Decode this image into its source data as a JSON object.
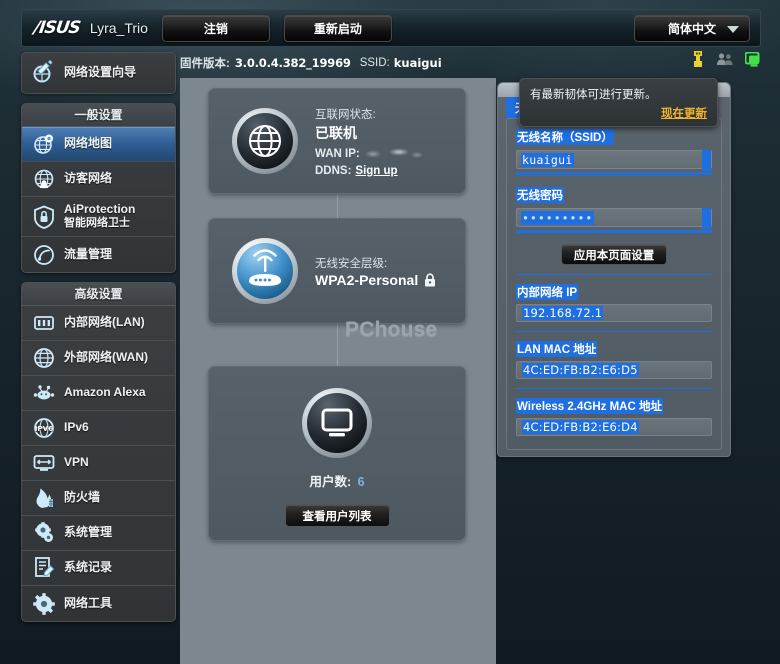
{
  "header": {
    "brand": "/ISUS",
    "model": "Lyra_Trio",
    "logout_label": "注销",
    "reboot_label": "重新启动",
    "language": "简体中文"
  },
  "info": {
    "firmware_label": "固件版本:",
    "firmware_version": "3.0.0.4.382_19969",
    "ssid_label": "SSID:",
    "ssid_value": "kuaigui",
    "icons": [
      "usb-icon",
      "guest-users-icon",
      "client-monitor-icon"
    ]
  },
  "sidebar": {
    "wizard": {
      "label": "网络设置向导",
      "icon": "wizard-icon"
    },
    "general": {
      "title": "一般设置",
      "items": [
        {
          "label": "网络地图",
          "icon": "network-map-icon",
          "active": true
        },
        {
          "label": "访客网络",
          "icon": "guest-network-icon",
          "active": false
        },
        {
          "label": "AiProtection",
          "sublabel": "智能网络卫士",
          "icon": "aiprotection-icon",
          "active": false
        },
        {
          "label": "流量管理",
          "icon": "traffic-manager-icon",
          "active": false
        }
      ]
    },
    "advanced": {
      "title": "高级设置",
      "items": [
        {
          "label": "内部网络(LAN)",
          "icon": "lan-icon"
        },
        {
          "label": "外部网络(WAN)",
          "icon": "wan-icon"
        },
        {
          "label": "Amazon Alexa",
          "icon": "alexa-icon"
        },
        {
          "label": "IPv6",
          "icon": "ipv6-icon"
        },
        {
          "label": "VPN",
          "icon": "vpn-icon"
        },
        {
          "label": "防火墙",
          "icon": "firewall-icon"
        },
        {
          "label": "系统管理",
          "icon": "administration-icon"
        },
        {
          "label": "系统记录",
          "icon": "system-log-icon"
        },
        {
          "label": "网络工具",
          "icon": "network-tools-icon"
        }
      ]
    }
  },
  "main": {
    "internet": {
      "icon": "globe-icon",
      "status_label": "互联网状态:",
      "status_value": "已联机",
      "wan_ip_label": "WAN IP:",
      "wan_ip_value": "",
      "ddns_label": "DDNS:",
      "ddns_link": "Sign up"
    },
    "wireless": {
      "icon": "router-icon",
      "security_label": "无线安全层级:",
      "security_value": "WPA2-Personal",
      "lock_icon": "lock-icon"
    },
    "clients": {
      "icon": "monitor-icon",
      "count_label": "用户数:",
      "count_value": "6",
      "view_button": "查看用户列表"
    },
    "watermark": "PChouse"
  },
  "right_panel": {
    "tab_label": "无线连接",
    "ssid_field_label": "无线名称（SSID）",
    "ssid_field_value": "kuaigui",
    "password_field_label": "无线密码",
    "password_field_value": "•••••••••",
    "apply_button": "应用本页面设置",
    "readonly": [
      {
        "label": "内部网络 IP",
        "value": "192.168.72.1"
      },
      {
        "label": "LAN MAC 地址",
        "value": "4C:ED:FB:B2:E6:D5"
      },
      {
        "label": "Wireless 2.4GHz MAC 地址",
        "value": "4C:ED:FB:B2:E6:D4"
      }
    ]
  },
  "tooltip": {
    "message": "有最新韧体可进行更新。",
    "link": "现在更新"
  },
  "colors": {
    "accent_blue": "#1f6fe0",
    "sidebar_active": "#2f5d94",
    "update_link": "#f0b429",
    "content_bg": "#7c878f"
  }
}
